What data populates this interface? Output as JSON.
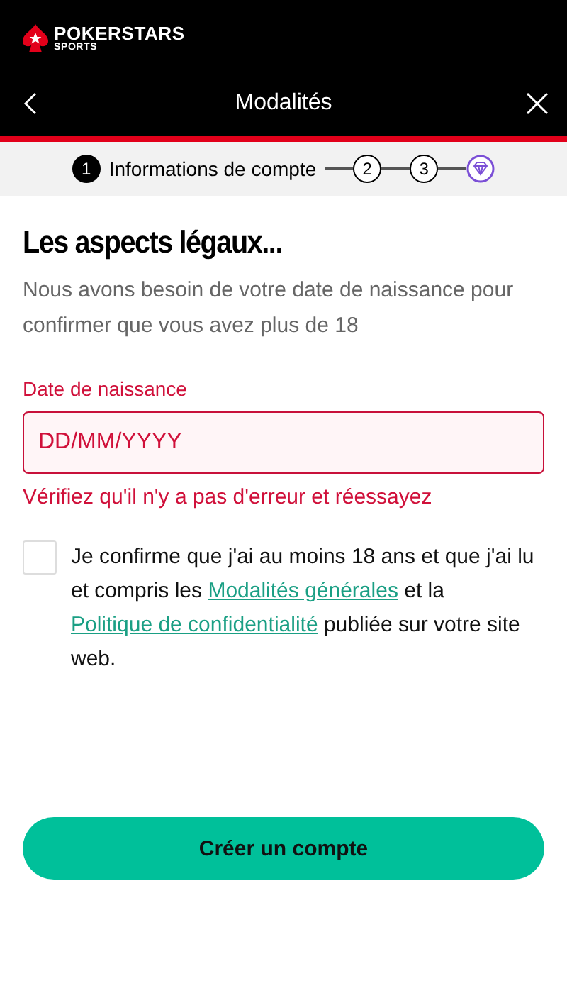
{
  "brand": {
    "name": "POKERSTARS",
    "sub": "SPORTS"
  },
  "header": {
    "title": "Modalités"
  },
  "steps": [
    {
      "kind": "number",
      "label": "1",
      "caption": "Informations de compte",
      "selected": true
    },
    {
      "kind": "number",
      "label": "2",
      "selected": false
    },
    {
      "kind": "number",
      "label": "3",
      "selected": false
    },
    {
      "kind": "diamond",
      "selected": false
    }
  ],
  "heading": "Les aspects légaux...",
  "intro": "Nous avons besoin de votre date de naissance pour confirmer que vous avez plus de 18",
  "birth_field": {
    "label": "Date de naissance",
    "placeholder": "DD/MM/YYYY",
    "error": "Vérifiez qu'il n'y a pas d'erreur et réessayez",
    "invalid": true
  },
  "consent": {
    "checked": false,
    "parts": [
      {
        "kind": "text",
        "text": "Je confirme que j'ai au moins 18 ans et que j'ai lu et compris les "
      },
      {
        "kind": "link",
        "text": "Modalités générales"
      },
      {
        "kind": "text",
        "text": " et la "
      },
      {
        "kind": "link",
        "text": "Politique de confidentialité"
      },
      {
        "kind": "text",
        "text": " publiée sur votre site web."
      }
    ]
  },
  "submit": "Créer un compte"
}
